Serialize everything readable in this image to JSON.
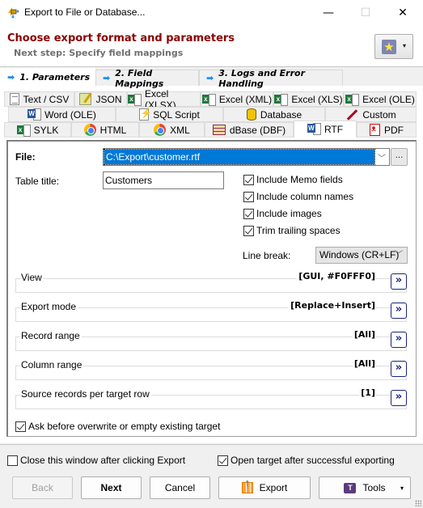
{
  "window": {
    "title": "Export to File or Database...",
    "controls": {
      "minimize": "—",
      "maximize": "☐",
      "close": "✕"
    }
  },
  "header": {
    "title": "Choose export format and parameters",
    "subtitle": "Next step: Specify field mappings",
    "favorites_icon": "★",
    "favorites_caret": "▾"
  },
  "wizard_tabs": [
    {
      "label": "1. Parameters",
      "icon": "arrow-right-icon",
      "active": true
    },
    {
      "label": "2. Field Mappings",
      "icon": "arrow-right-icon",
      "active": false
    },
    {
      "label": "3. Logs and Error Handling",
      "icon": "arrow-right-icon",
      "active": false
    }
  ],
  "format_tabs": {
    "row1": [
      {
        "label": "Text / CSV",
        "icon": "text-file-icon"
      },
      {
        "label": "JSON",
        "icon": "json-icon"
      },
      {
        "label": "Excel (XLSX)",
        "icon": "excel-icon"
      },
      {
        "label": "Excel (XML)",
        "icon": "excel-icon"
      },
      {
        "label": "Excel (XLS)",
        "icon": "excel-icon"
      },
      {
        "label": "Excel (OLE)",
        "icon": "excel-icon"
      }
    ],
    "row2": [
      {
        "label": "Word (OLE)",
        "icon": "word-icon"
      },
      {
        "label": "SQL Script",
        "icon": "sql-script-icon"
      },
      {
        "label": "Database",
        "icon": "database-icon"
      },
      {
        "label": "Custom",
        "icon": "custom-pen-icon"
      }
    ],
    "row3": [
      {
        "label": "SYLK",
        "icon": "sylk-icon"
      },
      {
        "label": "HTML",
        "icon": "chrome-icon"
      },
      {
        "label": "XML",
        "icon": "chrome-icon"
      },
      {
        "label": "dBase (DBF)",
        "icon": "dbase-icon"
      },
      {
        "label": "RTF",
        "icon": "word-icon",
        "active": true
      },
      {
        "label": "PDF",
        "icon": "pdf-icon"
      }
    ]
  },
  "form": {
    "file_label": "File:",
    "file_value": "C:\\Export\\customer.rtf",
    "browse_label": "...",
    "table_title_label": "Table title:",
    "table_title_value": "Customers",
    "checkboxes": [
      {
        "label": "Include Memo fields",
        "checked": true
      },
      {
        "label": "Include column names",
        "checked": true
      },
      {
        "label": "Include images",
        "checked": true
      },
      {
        "label": "Trim trailing spaces",
        "checked": true
      }
    ],
    "line_break_label": "Line break:",
    "line_break_value": "Windows (CR+LF)",
    "groups": [
      {
        "title": "View",
        "value": "[GUI, #F0FFF0]"
      },
      {
        "title": "Export mode",
        "value": "[Replace+Insert]"
      },
      {
        "title": "Record range",
        "value": "[All]"
      },
      {
        "title": "Column range",
        "value": "[All]"
      },
      {
        "title": "Source records per target row",
        "value": "[1]"
      }
    ],
    "more_label": "»",
    "ask_overwrite": {
      "label": "Ask before overwrite or empty existing target",
      "checked": true
    }
  },
  "footer": {
    "close_after_export": {
      "label": "Close this window after clicking Export",
      "checked": false
    },
    "open_target": {
      "label": "Open target after successful exporting",
      "checked": true
    },
    "buttons": {
      "back": "Back",
      "next": "Next",
      "cancel": "Cancel",
      "export": "Export",
      "tools": "Tools",
      "tools_caret": "▾"
    }
  }
}
